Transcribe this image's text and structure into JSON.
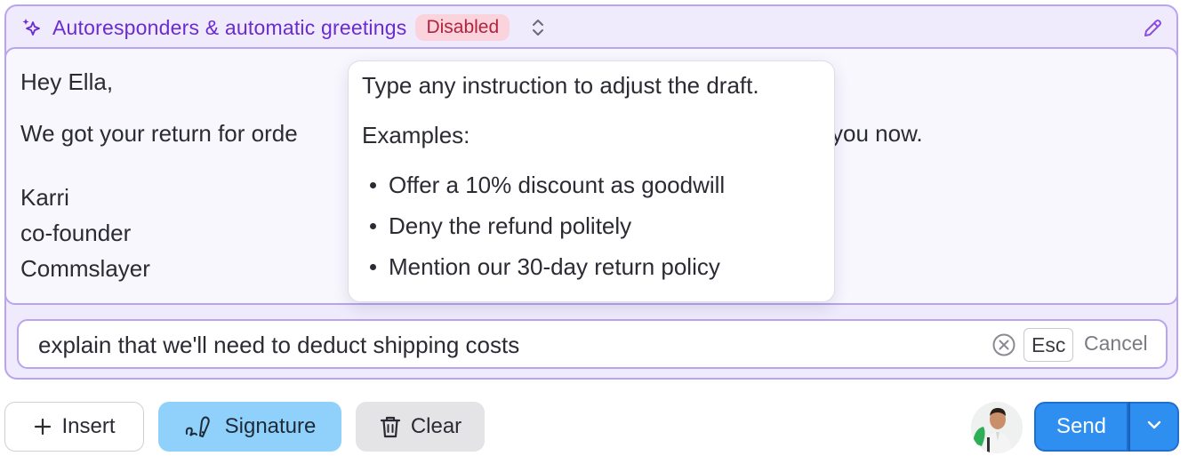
{
  "colors": {
    "accent_purple": "#6a2ccf",
    "panel_border": "#b9a4f0",
    "panel_bg": "#efeafc",
    "badge_bg": "#fbd3dc",
    "badge_text": "#b0243f",
    "send_blue": "#2f8ff0",
    "signature_blue": "#8fd1fb"
  },
  "header": {
    "icon": "sparkle-icon",
    "title": "Autoresponders & automatic greetings",
    "status_badge": "Disabled",
    "toggle_icon": "chevron-up-down-icon",
    "edit_icon": "pencil-icon"
  },
  "draft": {
    "greeting": "Hey Ella,",
    "body_start": "We got your return for orde",
    "body_end": "you now.",
    "signature_name": "Karri",
    "signature_role": "co-founder",
    "signature_company": "Commslayer"
  },
  "tooltip": {
    "intro": "Type any instruction to adjust the draft.",
    "examples_label": "Examples:",
    "examples": [
      "Offer a 10% discount as goodwill",
      "Deny the refund politely",
      "Mention our 30-day return policy"
    ]
  },
  "instruction": {
    "value": "explain that we'll need to deduct shipping costs",
    "esc_key": "Esc",
    "cancel_label": "Cancel"
  },
  "toolbar": {
    "insert_label": "Insert",
    "signature_label": "Signature",
    "clear_label": "Clear",
    "send_label": "Send"
  }
}
